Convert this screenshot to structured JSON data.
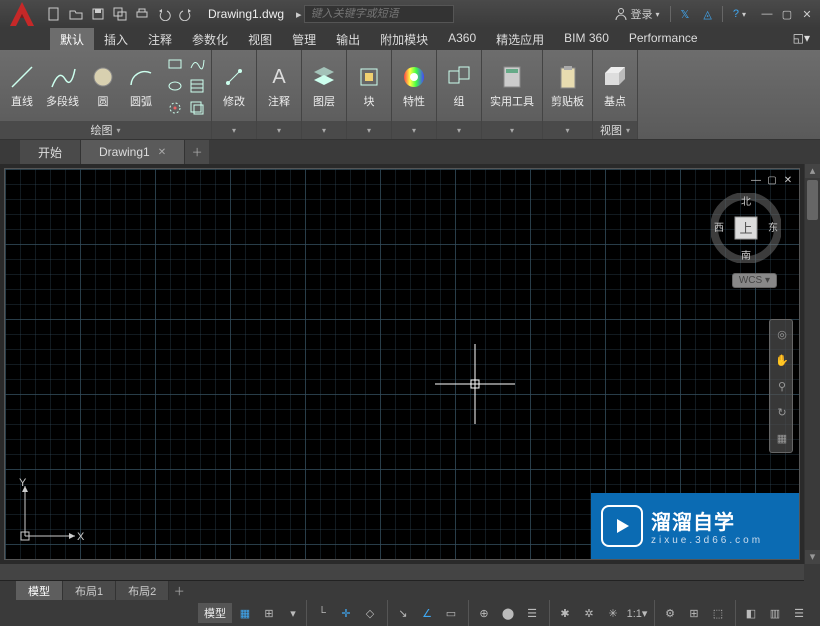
{
  "title": {
    "filename": "Drawing1.dwg",
    "search_placeholder": "键入关键字或短语",
    "login": "登录"
  },
  "ribbon_tabs": [
    "默认",
    "插入",
    "注释",
    "参数化",
    "视图",
    "管理",
    "输出",
    "附加模块",
    "A360",
    "精选应用",
    "BIM 360",
    "Performance"
  ],
  "ribbon_active_tab": 0,
  "ribbon": {
    "draw": {
      "title": "绘图",
      "line": "直线",
      "polyline": "多段线",
      "circle": "圆",
      "arc": "圆弧"
    },
    "modify": {
      "title": "修改"
    },
    "annotate": {
      "title": "注释"
    },
    "layers": {
      "title": "图层"
    },
    "block": {
      "title": "块"
    },
    "properties": {
      "title": "特性"
    },
    "group": {
      "title": "组"
    },
    "utilities": {
      "title": "实用工具"
    },
    "clipboard": {
      "title": "剪贴板"
    },
    "view": {
      "title": "视图",
      "base": "基点"
    }
  },
  "file_tabs": {
    "start": "开始",
    "doc": "Drawing1"
  },
  "viewcube": {
    "north": "北",
    "south": "南",
    "east": "东",
    "west": "西",
    "top": "上"
  },
  "wcs": "WCS",
  "layout_tabs": [
    "模型",
    "布局1",
    "布局2"
  ],
  "status": {
    "model": "模型"
  },
  "watermark": {
    "title": "溜溜自学",
    "sub": "zixue.3d66.com"
  }
}
